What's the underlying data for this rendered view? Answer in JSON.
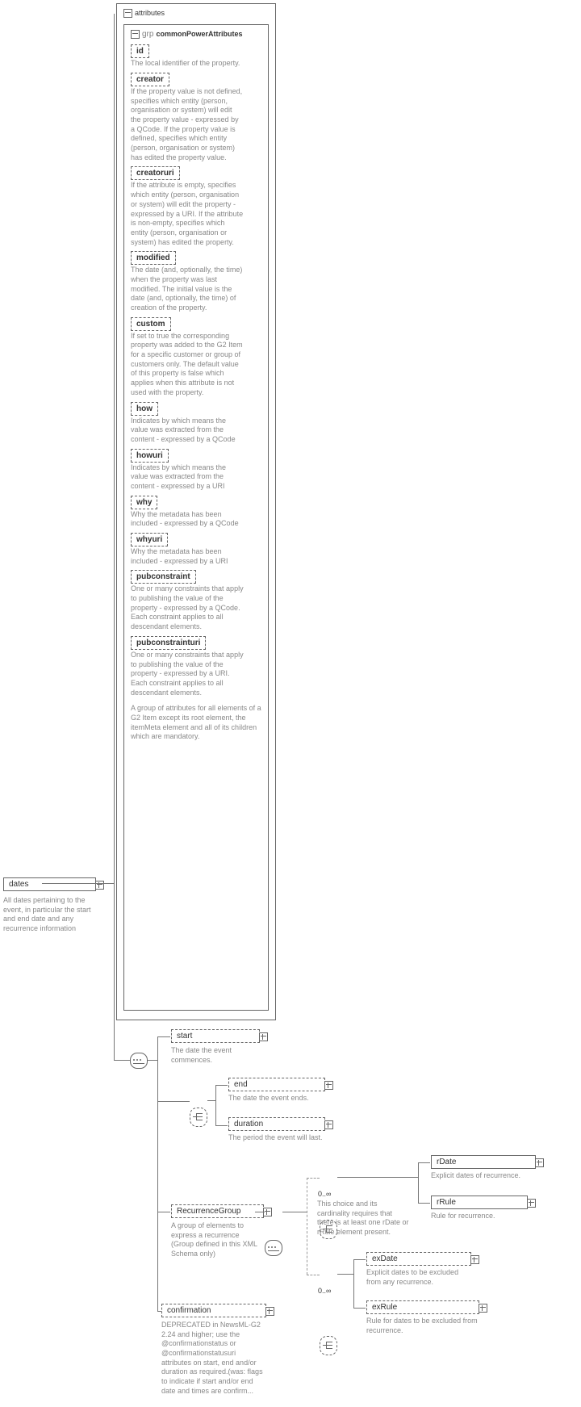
{
  "root": {
    "name": "dates",
    "desc": "All dates pertaining to the event, in particular the start and end date and any recurrence information"
  },
  "attr_box_label": "attributes",
  "group": {
    "prefix": "grp",
    "name": "commonPowerAttributes",
    "desc": "A group of attributes for all elements of a G2 Item except its root element, the itemMeta element and all of its children which are mandatory."
  },
  "attrs": [
    {
      "name": "id",
      "desc": "The local identifier of the property."
    },
    {
      "name": "creator",
      "desc": "If the property value is not defined, specifies which entity (person, organisation or system) will edit the property value - expressed by a QCode. If the property value is defined, specifies which entity (person, organisation or system) has edited the property value."
    },
    {
      "name": "creatoruri",
      "desc": "If the attribute is empty, specifies which entity (person, organisation or system) will edit the property - expressed by a URI. If the attribute is non-empty, specifies which entity (person, organisation or system) has edited the property."
    },
    {
      "name": "modified",
      "desc": "The date (and, optionally, the time) when the property was last modified. The initial value is the date (and, optionally, the time) of creation of the property."
    },
    {
      "name": "custom",
      "desc": "If set to true the corresponding property was added to the G2 Item for a specific customer or group of customers only. The default value of this property is false which applies when this attribute is not used with the property."
    },
    {
      "name": "how",
      "desc": "Indicates by which means the value was extracted from the content - expressed by a QCode"
    },
    {
      "name": "howuri",
      "desc": "Indicates by which means the value was extracted from the content - expressed by a URI"
    },
    {
      "name": "why",
      "desc": "Why the metadata has been included - expressed by a QCode"
    },
    {
      "name": "whyuri",
      "desc": "Why the metadata has been included - expressed by a URI"
    },
    {
      "name": "pubconstraint",
      "desc": "One or many constraints that apply to publishing the value of the property - expressed by a QCode. Each constraint applies to all descendant elements."
    },
    {
      "name": "pubconstrainturi",
      "desc": "One or many constraints that apply to publishing the value of the property - expressed by a URI. Each constraint applies to all descendant elements."
    }
  ],
  "elems": {
    "start": {
      "name": "start",
      "desc": "The date the event commences."
    },
    "end": {
      "name": "end",
      "desc": "The date the event ends."
    },
    "duration": {
      "name": "duration",
      "desc": "The period the event will last."
    },
    "recgroup": {
      "name": "RecurrenceGroup",
      "desc": "A group of elements to express a recurrence (Group defined in this XML Schema only)"
    },
    "rDate": {
      "name": "rDate",
      "desc": "Explicit dates of recurrence."
    },
    "rRule": {
      "name": "rRule",
      "desc": "Rule for recurrence."
    },
    "exDate": {
      "name": "exDate",
      "desc": "Explicit dates to be excluded from any recurrence."
    },
    "exRule": {
      "name": "exRule",
      "desc": "Rule for dates to be excluded from recurrence."
    },
    "confirmation": {
      "name": "confirmation",
      "desc": "DEPRECATED in NewsML-G2 2.24 and higher; use the @confirmationstatus or @confirmationstatusuri attributes on start, end and/or duration as required.(was: flags to indicate if start and/or end date and times are confirm..."
    }
  },
  "choice_note": "This choice and its cardinality requires that there is at least one rDate or rRule element present.",
  "cardinality": "0..∞",
  "chart_data": {
    "type": "tree",
    "root": "dates",
    "children": [
      {
        "node": "attributes",
        "group": "commonPowerAttributes",
        "attributes": [
          "id",
          "creator",
          "creatoruri",
          "modified",
          "custom",
          "how",
          "howuri",
          "why",
          "whyuri",
          "pubconstraint",
          "pubconstrainturi"
        ]
      },
      {
        "node": "sequence",
        "children": [
          {
            "node": "start",
            "optional": true
          },
          {
            "node": "choice",
            "optional": true,
            "children": [
              "end",
              "duration"
            ]
          },
          {
            "node": "RecurrenceGroup",
            "optional": true,
            "children": [
              {
                "node": "choice",
                "cardinality": "0..∞",
                "children": [
                  "rDate",
                  "rRule"
                ]
              },
              {
                "node": "choice",
                "cardinality": "0..∞",
                "children": [
                  "exDate",
                  "exRule"
                ]
              }
            ]
          },
          {
            "node": "confirmation",
            "optional": true
          }
        ]
      }
    ]
  }
}
